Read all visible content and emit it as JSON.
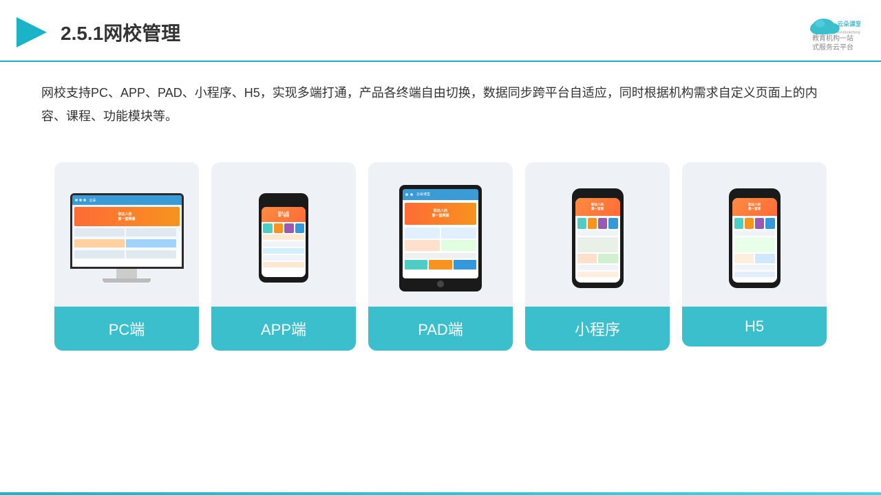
{
  "header": {
    "title": "2.5.1网校管理",
    "logo_name": "云朵课堂",
    "logo_url": "yunduoketang.com",
    "logo_slogan": "教育机构一站\n式服务云平台"
  },
  "description": {
    "text": "网校支持PC、APP、PAD、小程序、H5，实现多端打通，产品各终端自由切换，数据同步跨平台自适应，同时根据机构需求自定义页面上的内容、课程、功能模块等。"
  },
  "cards": [
    {
      "id": "pc",
      "label": "PC端"
    },
    {
      "id": "app",
      "label": "APP端"
    },
    {
      "id": "pad",
      "label": "PAD端"
    },
    {
      "id": "mini",
      "label": "小程序"
    },
    {
      "id": "h5",
      "label": "H5"
    }
  ],
  "colors": {
    "accent": "#1ab3c8",
    "card_bg": "#eef2f7",
    "label_bg": "#3bbfcd",
    "label_text": "#ffffff"
  }
}
